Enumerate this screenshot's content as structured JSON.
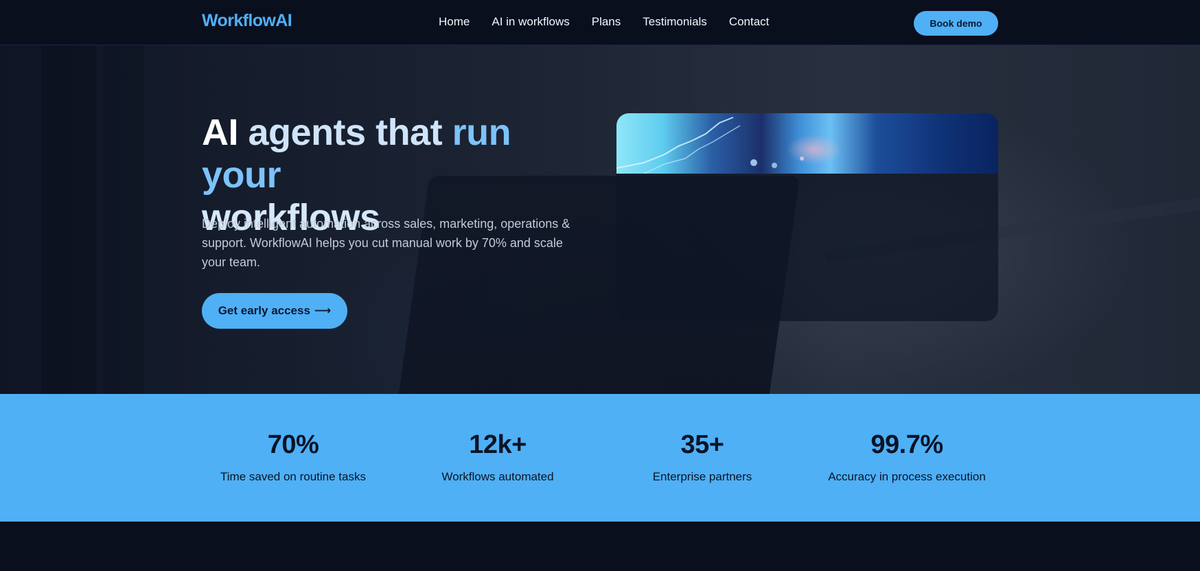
{
  "nav": {
    "logo": "WorkflowAI",
    "links": [
      "Home",
      "AI in workflows",
      "Plans",
      "Testimonials",
      "Contact"
    ],
    "book_demo_label": "Book demo"
  },
  "hero": {
    "title_parts": [
      "AI",
      "agents",
      "that",
      "run your",
      "workflows"
    ],
    "description": "Deploy intelligent automation across sales, marketing, operations & support. WorkflowAI helps you cut manual work by 70% and scale your team.",
    "cta_label": "Get early access",
    "cta_arrow": "⟶"
  },
  "stats": [
    {
      "value": "70%",
      "label": "Time saved on routine tasks"
    },
    {
      "value": "12k+",
      "label": "Workflows automated"
    },
    {
      "value": "35+",
      "label": "Enterprise partners"
    },
    {
      "value": "99.7%",
      "label": "Accuracy in process execution"
    }
  ],
  "colors": {
    "accent": "#4fb0f6",
    "nav_bg": "#0a0f1e",
    "stats_bg": "#4fb0f6",
    "title_highlight": "#7cc3fa"
  }
}
